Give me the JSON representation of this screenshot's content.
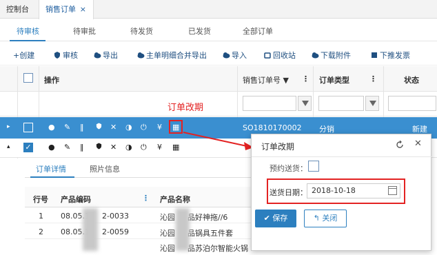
{
  "tabs": {
    "console": "控制台",
    "sales_order": "销售订单",
    "close": "×"
  },
  "subtabs": [
    "待审核",
    "待审批",
    "待发货",
    "已发货",
    "全部订单"
  ],
  "toolbar": [
    "+创建",
    "审核",
    "导出",
    "主单明细合并导出",
    "导入",
    "回收站",
    "下载附件",
    "下推发票"
  ],
  "grid": {
    "headers": {
      "ops": "操作",
      "order_no": "销售订单号 ▼",
      "order_type": "订单类型",
      "status": "状态",
      "menu": "⋮"
    },
    "rows": [
      {
        "order_no": "SO1810170002",
        "type": "分销",
        "status": "新建"
      }
    ],
    "row_icons": [
      "●",
      "✎",
      "‖",
      "◐",
      "✕",
      "◑",
      "⏻",
      "¥",
      "▦"
    ]
  },
  "annotation": "订单改期",
  "detail": {
    "tabs": [
      "订单详情",
      "照片信息"
    ],
    "headers": {
      "line": "行号",
      "code": "产品编码",
      "name": "产品名称",
      "menu": "⋮"
    },
    "rows": [
      {
        "line": "1",
        "code_a": "08.05.1",
        "code_b": "2-0033",
        "name_a": "沁园",
        "name_b": "品好神拖//6"
      },
      {
        "line": "2",
        "code_a": "08.05.1",
        "code_b": "2-0059",
        "name_a": "沁园",
        "name_b": "品锅具五件套"
      },
      {
        "line": "",
        "code_a": "",
        "code_b": "",
        "name_a": "沁园",
        "name_b": "品苏泊尔智能火锅"
      }
    ]
  },
  "dialog": {
    "title": "订单改期",
    "prebook_label": "预约送货：",
    "date_label": "送货日期：",
    "date_value": "2018-10-18",
    "save": "保存",
    "close": "关闭"
  },
  "colors": {
    "primary": "#2c7fbf",
    "selected_row": "#3a8fd0",
    "annotation": "#e32222"
  }
}
